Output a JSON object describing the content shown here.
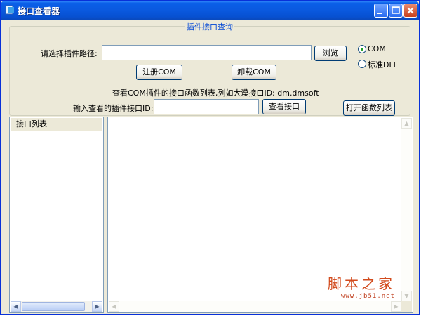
{
  "window": {
    "title": "接口查看器"
  },
  "group": {
    "title": "插件接口查询"
  },
  "path": {
    "label": "请选择插件路径:",
    "value": "",
    "browse_label": "浏览"
  },
  "mode": {
    "options": [
      "COM",
      "标准DLL"
    ],
    "selected": "COM"
  },
  "actions": {
    "register_label": "注册COM",
    "unregister_label": "卸载COM"
  },
  "hint": {
    "text": "查看COM插件的接口函数列表,列如大漠接口ID: dm.dmsoft"
  },
  "interface": {
    "label": "输入查看的插件接口ID:",
    "value": "",
    "view_label": "查看接口",
    "open_list_label": "打开函数列表"
  },
  "list": {
    "header": "接口列表",
    "items": []
  },
  "output": {
    "text": ""
  },
  "watermark": {
    "text": "脚本之家",
    "url": "www.jb51.net"
  }
}
